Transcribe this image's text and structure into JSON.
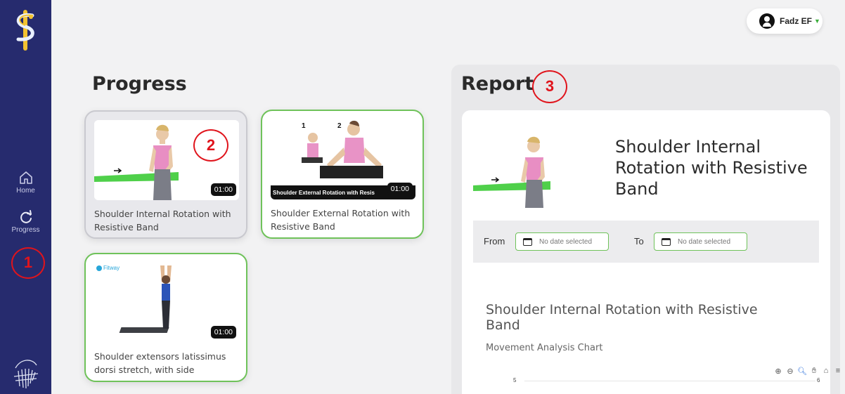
{
  "sidebar": {
    "items": [
      {
        "label": "Home",
        "icon": "home-icon"
      },
      {
        "label": "Progress",
        "icon": "progress-icon"
      }
    ],
    "background": "#262b6e"
  },
  "annotations": [
    "1",
    "2",
    "3"
  ],
  "user": {
    "name": "Fadz EF"
  },
  "progress": {
    "title": "Progress",
    "cards": [
      {
        "title": "Shoulder Internal Rotation with Resistive Band",
        "duration": "01:00",
        "state": "selected"
      },
      {
        "title": "Shoulder External Rotation with Resistive Band",
        "duration": "01:00",
        "state": "completed",
        "thumb_caption": "Shoulder External Rotation with Resis",
        "step_labels": [
          "1",
          "2"
        ]
      },
      {
        "title": "Shoulder extensors latissimus dorsi stretch, with side bending...",
        "duration": "01:00",
        "state": "completed",
        "thumb_brand": "Fitway"
      }
    ]
  },
  "report": {
    "title": "Report",
    "exercise_title": "Shoulder Internal Rotation with Resistive Band",
    "from_label": "From",
    "to_label": "To",
    "from_placeholder": "No date selected",
    "to_placeholder": "No date selected",
    "chart_title": "Shoulder Internal Rotation with Resistive Band",
    "chart_subtitle": "Movement Analysis Chart",
    "axis_left_tick": "5",
    "axis_right_tick": "6"
  },
  "colors": {
    "accent_green": "#6fc25a",
    "annotation_red": "#e0141c",
    "sidebar": "#262b6e"
  }
}
